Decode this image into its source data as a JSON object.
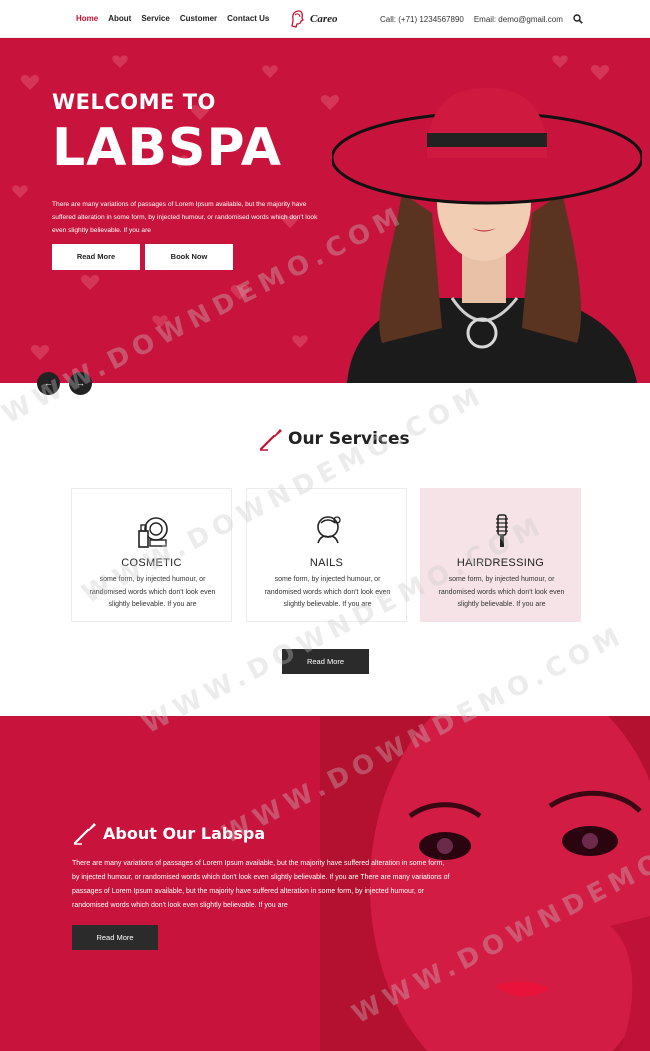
{
  "nav": {
    "items": [
      {
        "label": "Home",
        "active": true
      },
      {
        "label": "About"
      },
      {
        "label": "Service"
      },
      {
        "label": "Customer"
      },
      {
        "label": "Contact Us"
      }
    ]
  },
  "logo": {
    "text": "Careo"
  },
  "contact": {
    "call": "Call: (+71) 1234567890",
    "email": "Email: demo@gmail.com",
    "search_icon": "search-icon"
  },
  "hero": {
    "title_line1": "WELCOME TO",
    "title_line2": "LABSPA",
    "description": "There are many variations of passages of Lorem Ipsum available, but the majority have suffered alteration in some form, by injected humour, or randomised words which don't look even slightly believable. If you are",
    "read_more": "Read More",
    "book_now": "Book Now",
    "prev_arrow": "←",
    "next_arrow": "→"
  },
  "services": {
    "heading": "Our Services",
    "cards": [
      {
        "title": "COSMETIC",
        "text": "some form, by injected humour, or randomised words which don't look even slightly believable. If you are",
        "icon": "cosmetic-icon"
      },
      {
        "title": "NAILS",
        "text": "some form, by injected humour, or randomised words which don't look even slightly believable. If you are",
        "icon": "nails-icon"
      },
      {
        "title": "HAIRDRESSING",
        "text": "some form, by injected humour, or randomised words which don't look even slightly believable. If you are",
        "icon": "hair-brush-icon"
      }
    ],
    "read_more": "Read More"
  },
  "about": {
    "heading": "About Our Labspa",
    "description": "There are many variations of passages of Lorem Ipsum available, but the majority have suffered alteration in some form, by injected humour, or randomised words which don't look even slightly believable. If you are There are many variations of passages of Lorem Ipsum available, but the majority have suffered alteration in some form, by injected humour, or randomised words which don't look even slightly believable. If you are",
    "read_more": "Read More"
  },
  "watermark": "WWW.DOWNDEMO.COM",
  "colors": {
    "accent": "#c8143c",
    "dark": "#2b2b2b",
    "pink_card": "#f6e3e8"
  }
}
